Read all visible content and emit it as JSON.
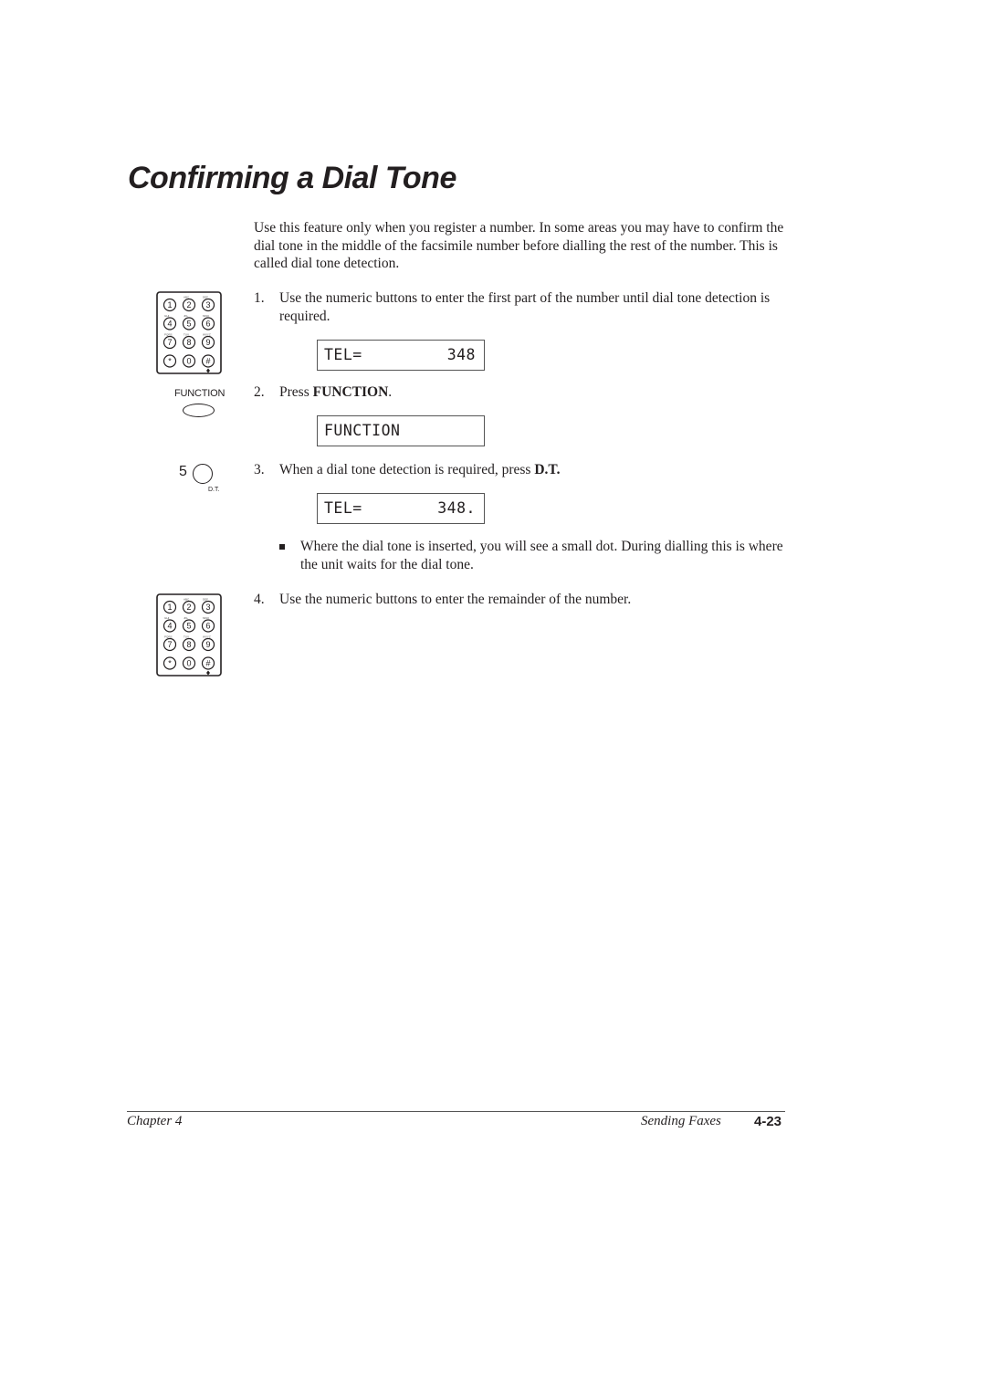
{
  "title": "Confirming a Dial Tone",
  "intro": "Use this feature only when you register a number. In some areas you may have to confirm the dial tone in the middle of the facsimile number before dialling the rest of the number. This is called dial tone detection.",
  "steps": [
    {
      "number": "1.",
      "text": "Use the numeric buttons to enter the first part of the number until dial tone detection is required.",
      "display": {
        "left": "TEL=",
        "right": "348"
      }
    },
    {
      "number": "2.",
      "prefix": "Press ",
      "bold": "FUNCTION",
      "suffix": ".",
      "display": {
        "left": "FUNCTION",
        "right": ""
      }
    },
    {
      "number": "3.",
      "prefix": "When a dial tone detection is required, press ",
      "bold": "D.T.",
      "suffix": "",
      "display": {
        "left": "TEL=",
        "right": "348."
      }
    },
    {
      "number": "4.",
      "text": "Use the numeric buttons to enter the remainder of the number."
    }
  ],
  "note": "Where the dial tone is inserted, you will see a small dot. During dialling this is where the unit waits for the dial tone.",
  "keypad": {
    "keys": [
      "1",
      "2",
      "3",
      "4",
      "5",
      "6",
      "7",
      "8",
      "9",
      "*",
      "0",
      "#"
    ],
    "letters": [
      "",
      "ABC",
      "DEF",
      "GHI",
      "JKL",
      "MNO",
      "PQRS",
      "TUV",
      "WXYZ",
      "",
      "",
      ""
    ]
  },
  "function_button": {
    "label": "FUNCTION"
  },
  "dt_button": {
    "number": "5",
    "label": "D.T."
  },
  "footer": {
    "chapter": "Chapter 4",
    "section": "Sending Faxes",
    "page": "4-23"
  }
}
